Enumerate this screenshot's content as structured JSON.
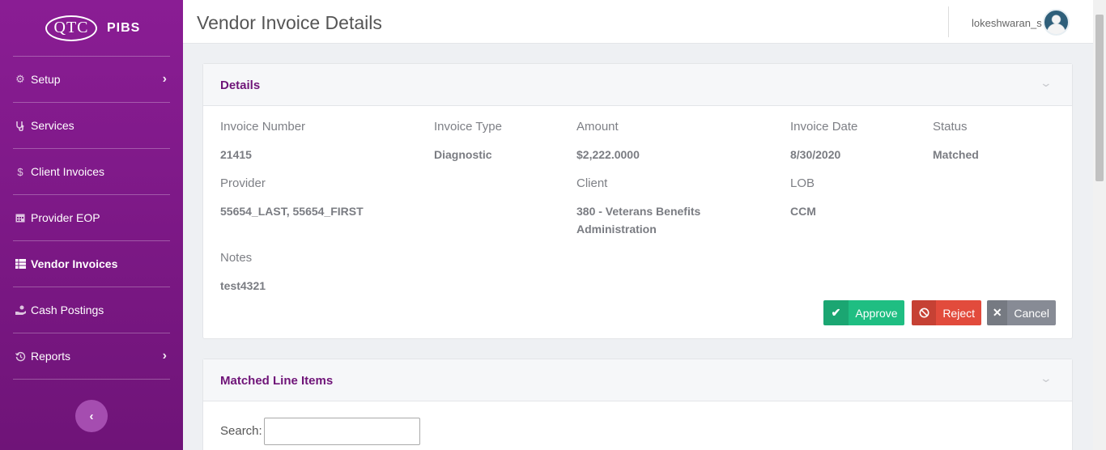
{
  "brand": {
    "logo_text": "QTC",
    "app_name": "PIBS"
  },
  "sidebar": {
    "items": [
      {
        "label": "Setup",
        "icon": "gear-icon",
        "has_chevron": true
      },
      {
        "label": "Services",
        "icon": "stethoscope-icon",
        "has_chevron": false
      },
      {
        "label": "Client Invoices",
        "icon": "dollar-icon",
        "has_chevron": false
      },
      {
        "label": "Provider EOP",
        "icon": "calendar-icon",
        "has_chevron": false
      },
      {
        "label": "Vendor Invoices",
        "icon": "table-icon",
        "has_chevron": false,
        "active": true
      },
      {
        "label": "Cash Postings",
        "icon": "hand-coin-icon",
        "has_chevron": false
      },
      {
        "label": "Reports",
        "icon": "history-icon",
        "has_chevron": true
      }
    ],
    "collapse_icon": "chevron-left-icon"
  },
  "header": {
    "title": "Vendor Invoice Details",
    "username": "lokeshwaran_s"
  },
  "details": {
    "title": "Details",
    "invoice_number": {
      "label": "Invoice Number",
      "value": "21415"
    },
    "invoice_type": {
      "label": "Invoice Type",
      "value": "Diagnostic"
    },
    "amount": {
      "label": "Amount",
      "value": "$2,222.0000"
    },
    "invoice_date": {
      "label": "Invoice Date",
      "value": "8/30/2020"
    },
    "status": {
      "label": "Status",
      "value": "Matched"
    },
    "provider": {
      "label": "Provider",
      "value": "55654_LAST, 55654_FIRST"
    },
    "client": {
      "label": "Client",
      "value_line1": "380 - Veterans Benefits",
      "value_line2": "Administration"
    },
    "lob": {
      "label": "LOB",
      "value": "CCM"
    },
    "notes": {
      "label": "Notes",
      "value": "test4321"
    }
  },
  "actions": {
    "approve": "Approve",
    "reject": "Reject",
    "cancel": "Cancel"
  },
  "matched": {
    "title": "Matched Line Items",
    "search_label": "Search:",
    "search_value": ""
  },
  "colors": {
    "sidebar": "#7f1a89",
    "accent": "#6f1478",
    "approve": "#1fbe82",
    "reject": "#e24b3c",
    "cancel": "#878b95"
  }
}
